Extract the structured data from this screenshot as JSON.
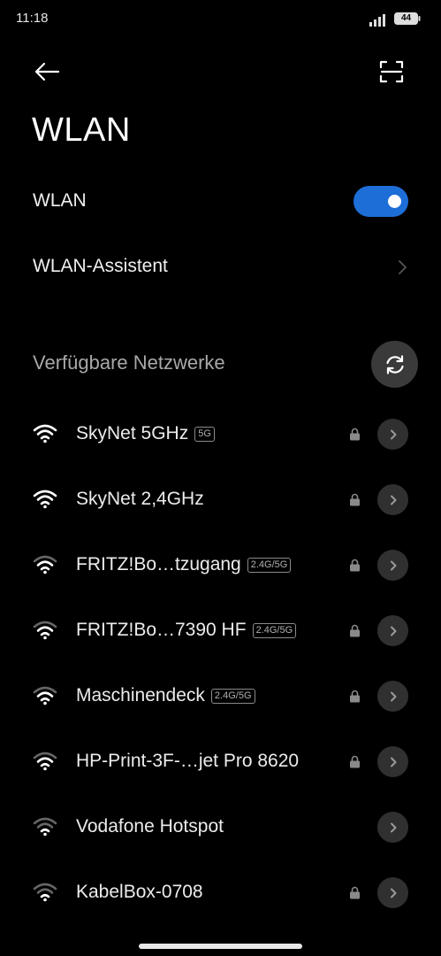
{
  "status_bar": {
    "time": "11:18",
    "battery": "44"
  },
  "header": {
    "title": "WLAN"
  },
  "wlan_row": {
    "label": "WLAN",
    "enabled": true
  },
  "assistant_row": {
    "label": "WLAN-Assistent"
  },
  "networks_section": {
    "title": "Verfügbare Netzwerke",
    "items": [
      {
        "ssid": "SkyNet 5GHz",
        "band": "5G",
        "secured": true
      },
      {
        "ssid": "SkyNet 2,4GHz",
        "band": "",
        "secured": true
      },
      {
        "ssid": "FRITZ!Bo…tzugang",
        "band": "2.4G/5G",
        "secured": true
      },
      {
        "ssid": "FRITZ!Bo…7390 HF",
        "band": "2.4G/5G",
        "secured": true
      },
      {
        "ssid": "Maschinendeck",
        "band": "2.4G/5G",
        "secured": true
      },
      {
        "ssid": "HP-Print-3F-…jet Pro 8620",
        "band": "",
        "secured": true
      },
      {
        "ssid": "Vodafone Hotspot",
        "band": "",
        "secured": false
      },
      {
        "ssid": "KabelBox-0708",
        "band": "",
        "secured": true
      }
    ]
  },
  "colors": {
    "accent": "#1e6ed8",
    "background": "#000000"
  }
}
